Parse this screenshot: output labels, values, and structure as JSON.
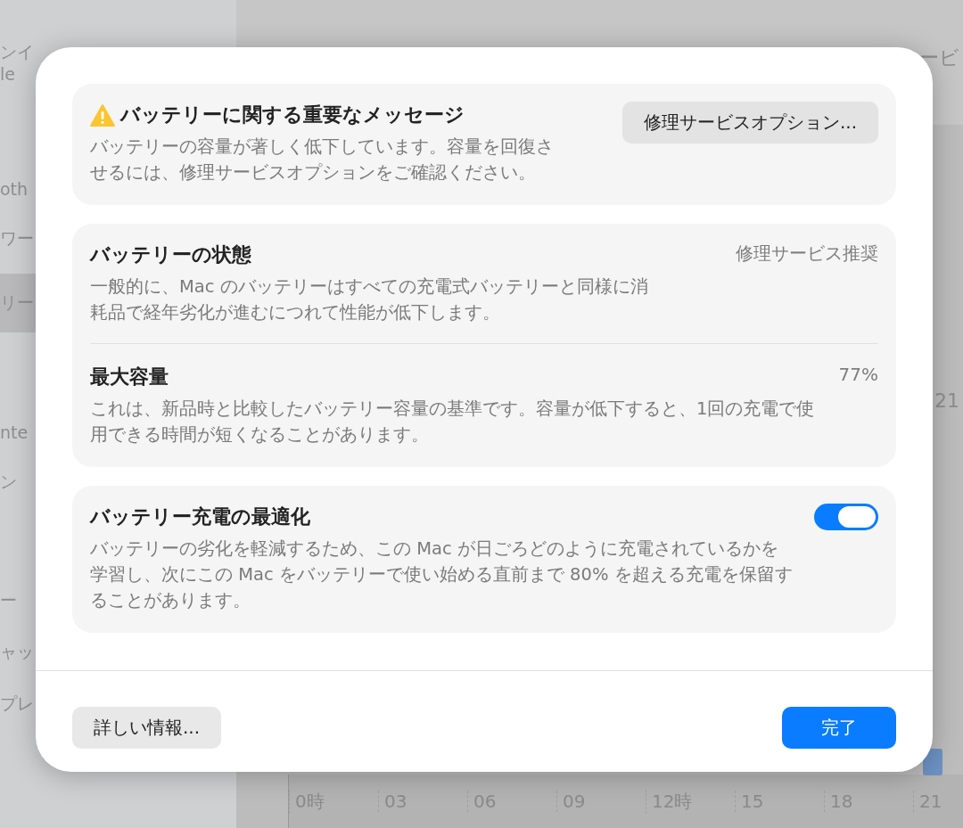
{
  "background": {
    "sidebar_groups": [
      {
        "items": [
          {
            "label": "ンイ",
            "sublabel": "le",
            "selected": false
          }
        ]
      },
      {
        "items": [
          {
            "label": "oth",
            "selected": false
          },
          {
            "label": "ワー",
            "selected": false
          },
          {
            "label": "リー",
            "selected": true
          }
        ]
      },
      {
        "items": [
          {
            "label": "nte",
            "selected": false
          },
          {
            "label": "ン",
            "selected": false
          }
        ]
      },
      {
        "items": [
          {
            "label": "ー",
            "selected": false
          },
          {
            "label": "ャッ",
            "selected": false
          },
          {
            "label": "プレ",
            "selected": false
          }
        ]
      }
    ],
    "main_heading": "ービ",
    "side_value": "21",
    "axis_labels": [
      "0時",
      "03",
      "06",
      "09",
      "12時",
      "15",
      "18",
      "21"
    ]
  },
  "dialog": {
    "alert": {
      "title": "バッテリーに関する重要なメッセージ",
      "message": "バッテリーの容量が著しく低下しています。容量を回復させるには、修理サービスオプションをご確認ください。",
      "button": "修理サービスオプション..."
    },
    "health": [
      {
        "title": "バッテリーの状態",
        "value": "修理サービス推奨",
        "description": "一般的に、Mac のバッテリーはすべての充電式バッテリーと同様に消耗品で経年劣化が進むにつれて性能が低下します。"
      },
      {
        "title": "最大容量",
        "value": "77%",
        "description": "これは、新品時と比較したバッテリー容量の基準です。容量が低下すると、1回の充電で使用できる時間が短くなることがあります。"
      }
    ],
    "optimize": {
      "title": "バッテリー充電の最適化",
      "on": true,
      "description": "バッテリーの劣化を軽減するため、この Mac が日ごろどのように充電されているかを学習し、次にこの Mac をバッテリーで使い始める直前まで 80% を超える充電を保留することがあります。"
    },
    "buttons": [
      {
        "label": "詳しい情報...",
        "kind": "secondary"
      },
      {
        "label": "完了",
        "kind": "primary"
      }
    ]
  }
}
